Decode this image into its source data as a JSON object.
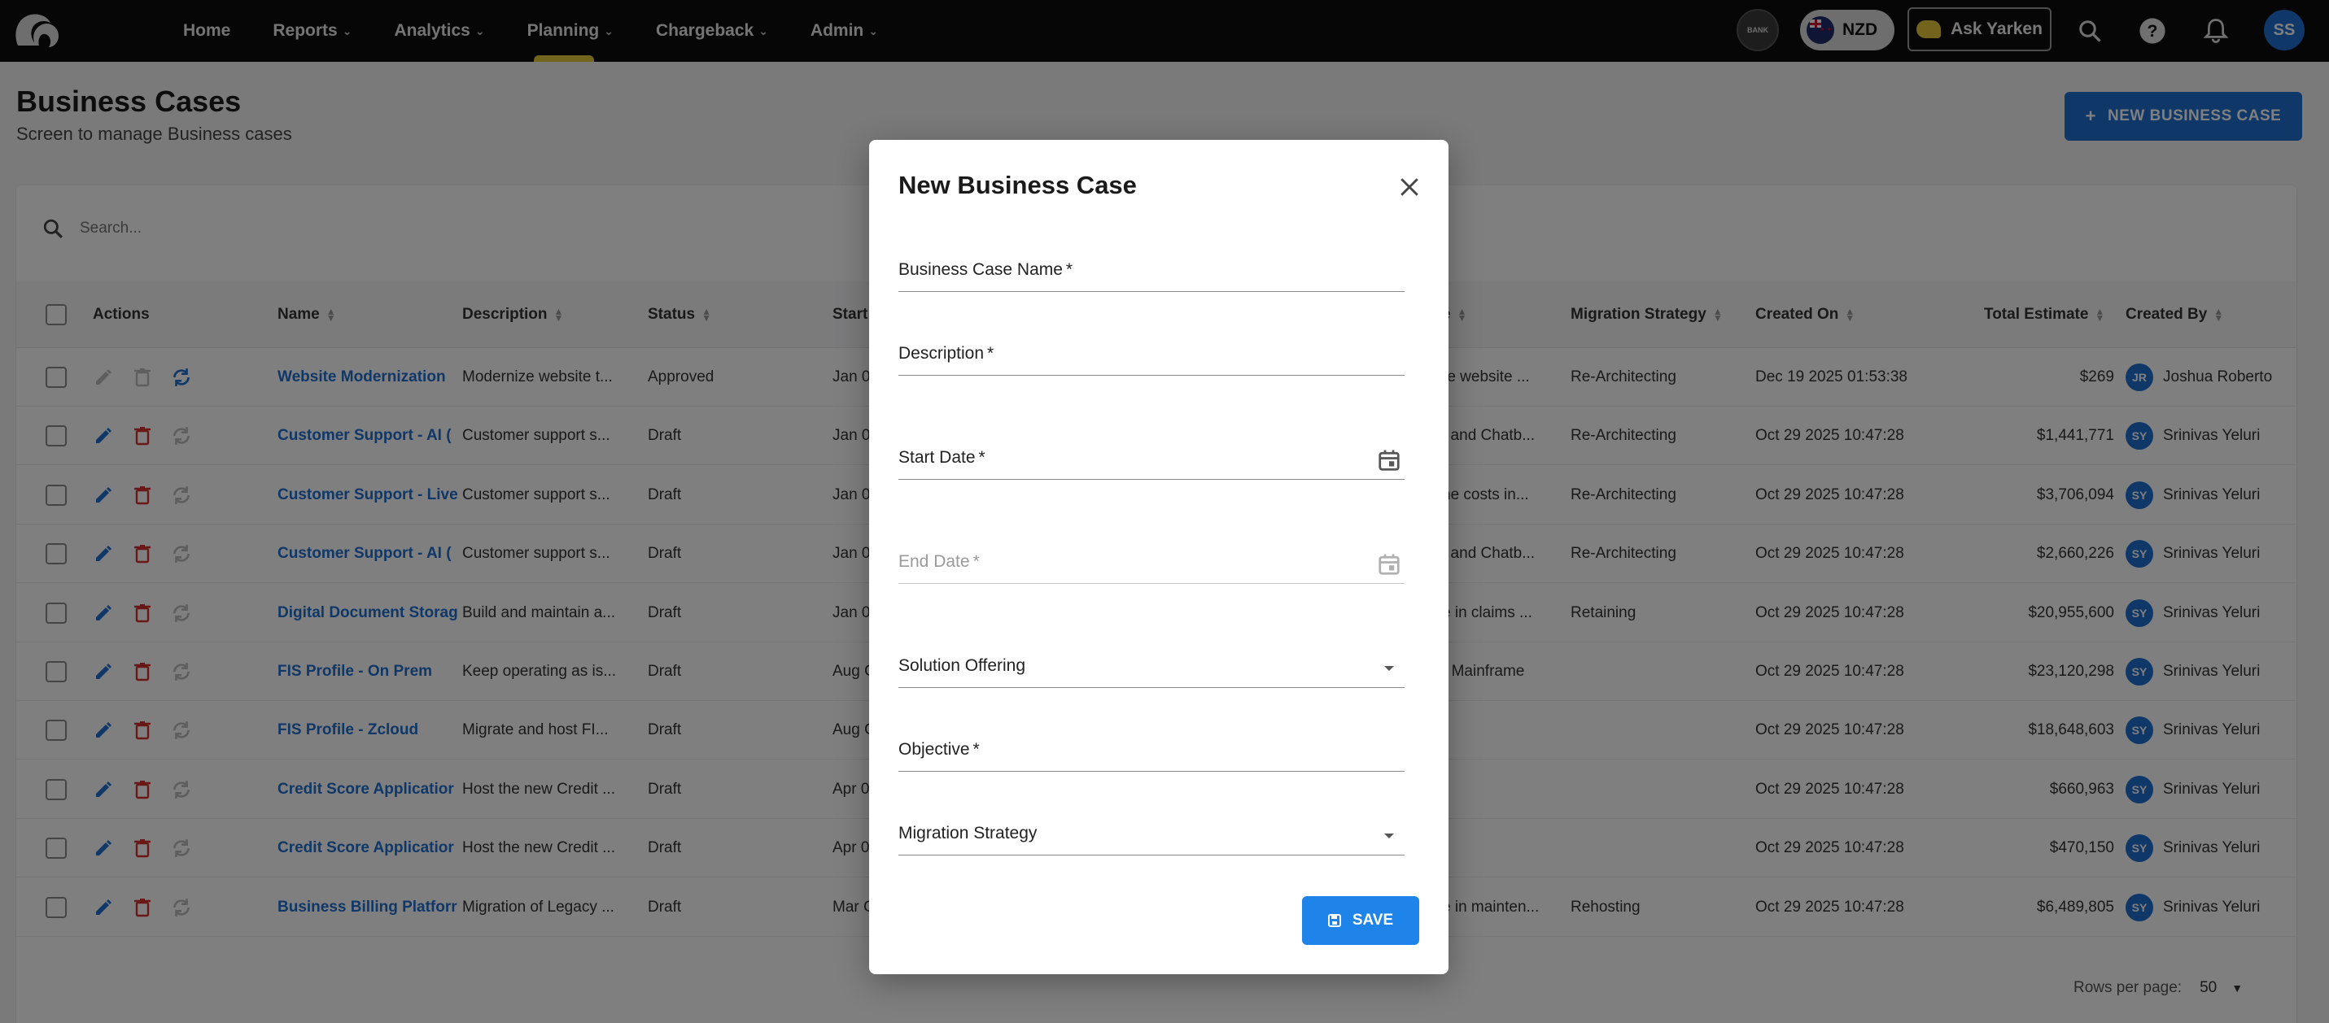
{
  "nav": {
    "items": [
      {
        "label": "Home",
        "has_menu": false
      },
      {
        "label": "Reports",
        "has_menu": true
      },
      {
        "label": "Analytics",
        "has_menu": true
      },
      {
        "label": "Planning",
        "has_menu": true,
        "active": true
      },
      {
        "label": "Chargeback",
        "has_menu": true
      },
      {
        "label": "Admin",
        "has_menu": true
      }
    ],
    "bank_label": "BANK",
    "currency": "NZD",
    "ask_label": "Ask Yarken",
    "user_initials": "SS",
    "accent_color": "#e7c83a"
  },
  "page": {
    "title": "Business Cases",
    "subtitle": "Screen to manage Business cases",
    "new_button_label": "NEW BUSINESS CASE"
  },
  "search": {
    "placeholder": "Search..."
  },
  "table": {
    "headers": {
      "actions": "Actions",
      "name": "Name",
      "description": "Description",
      "status": "Status",
      "start": "Start",
      "e": "e",
      "migration_strategy": "Migration Strategy",
      "created_on": "Created On",
      "total_estimate": "Total Estimate",
      "created_by": "Created By"
    },
    "rows": [
      {
        "name": "Website Modernization",
        "description": "Modernize website t...",
        "status": "Approved",
        "start": "Jan 0",
        "hidden_desc": "re website ...",
        "migration": "Re-Architecting",
        "created_on": "Dec 19 2025 01:53:38",
        "total": "$269",
        "initials": "JR",
        "created_by": "Joshua Roberto",
        "editable": false
      },
      {
        "name": "Customer Support - AI (",
        "description": "Customer support s...",
        "status": "Draft",
        "start": "Jan 0",
        "hidden_desc": "t and Chatb...",
        "migration": "Re-Architecting",
        "created_on": "Oct 29 2025 10:47:28",
        "total": "$1,441,771",
        "initials": "SY",
        "created_by": "Srinivas Yeluri",
        "editable": true
      },
      {
        "name": "Customer Support - Live",
        "description": "Customer support s...",
        "status": "Draft",
        "start": "Jan 0",
        "hidden_desc": "he costs in...",
        "migration": "Re-Architecting",
        "created_on": "Oct 29 2025 10:47:28",
        "total": "$3,706,094",
        "initials": "SY",
        "created_by": "Srinivas Yeluri",
        "editable": true
      },
      {
        "name": "Customer Support - AI (",
        "description": "Customer support s...",
        "status": "Draft",
        "start": "Jan 0",
        "hidden_desc": "t and Chatb...",
        "migration": "Re-Architecting",
        "created_on": "Oct 29 2025 10:47:28",
        "total": "$2,660,226",
        "initials": "SY",
        "created_by": "Srinivas Yeluri",
        "editable": true
      },
      {
        "name": "Digital Document Storag",
        "description": "Build and maintain a...",
        "status": "Draft",
        "start": "Jan 0",
        "hidden_desc": "e in claims ...",
        "migration": "Retaining",
        "created_on": "Oct 29 2025 10:47:28",
        "total": "$20,955,600",
        "initials": "SY",
        "created_by": "Srinivas Yeluri",
        "editable": true
      },
      {
        "name": "FIS Profile - On Prem",
        "description": "Keep operating as is...",
        "status": "Draft",
        "start": "Aug C",
        "hidden_desc": "- Mainframe",
        "migration": "",
        "created_on": "Oct 29 2025 10:47:28",
        "total": "$23,120,298",
        "initials": "SY",
        "created_by": "Srinivas Yeluri",
        "editable": true
      },
      {
        "name": "FIS Profile - Zcloud",
        "description": "Migrate and host FI...",
        "status": "Draft",
        "start": "Aug C",
        "hidden_desc": "",
        "migration": "",
        "created_on": "Oct 29 2025 10:47:28",
        "total": "$18,648,603",
        "initials": "SY",
        "created_by": "Srinivas Yeluri",
        "editable": true
      },
      {
        "name": "Credit Score Applicatior",
        "description": "Host the new Credit ...",
        "status": "Draft",
        "start": "Apr 0",
        "hidden_desc": "",
        "migration": "",
        "created_on": "Oct 29 2025 10:47:28",
        "total": "$660,963",
        "initials": "SY",
        "created_by": "Srinivas Yeluri",
        "editable": true
      },
      {
        "name": "Credit Score Applicatior",
        "description": "Host the new Credit ...",
        "status": "Draft",
        "start": "Apr 0",
        "hidden_desc": "",
        "migration": "",
        "created_on": "Oct 29 2025 10:47:28",
        "total": "$470,150",
        "initials": "SY",
        "created_by": "Srinivas Yeluri",
        "editable": true
      },
      {
        "name": "Business Billing Platforr",
        "description": "Migration of Legacy ...",
        "status": "Draft",
        "start": "Mar C",
        "hidden_desc": "e in mainten...",
        "migration": "Rehosting",
        "created_on": "Oct 29 2025 10:47:28",
        "total": "$6,489,805",
        "initials": "SY",
        "created_by": "Srinivas Yeluri",
        "editable": true
      }
    ],
    "footer": {
      "rows_per_page_label": "Rows per page:",
      "rows_per_page_value": "50"
    }
  },
  "dialog": {
    "title": "New Business Case",
    "fields": [
      {
        "label": "Business Case Name",
        "required": "*",
        "kind": "text",
        "disabled": false
      },
      {
        "label": "Description",
        "required": "*",
        "kind": "text",
        "disabled": false
      },
      {
        "label": "Start Date",
        "required": "*",
        "kind": "date",
        "disabled": false
      },
      {
        "label": "End Date",
        "required": "*",
        "kind": "date",
        "disabled": true
      },
      {
        "label": "Solution Offering",
        "required": "",
        "kind": "select",
        "disabled": false
      },
      {
        "label": "Objective",
        "required": "*",
        "kind": "text",
        "disabled": false
      },
      {
        "label": "Migration Strategy",
        "required": "",
        "kind": "select",
        "disabled": false
      }
    ],
    "save_label": "SAVE"
  },
  "colors": {
    "primary": "#1f6fd1",
    "danger": "#d32f2f",
    "save": "#1f84ea"
  }
}
